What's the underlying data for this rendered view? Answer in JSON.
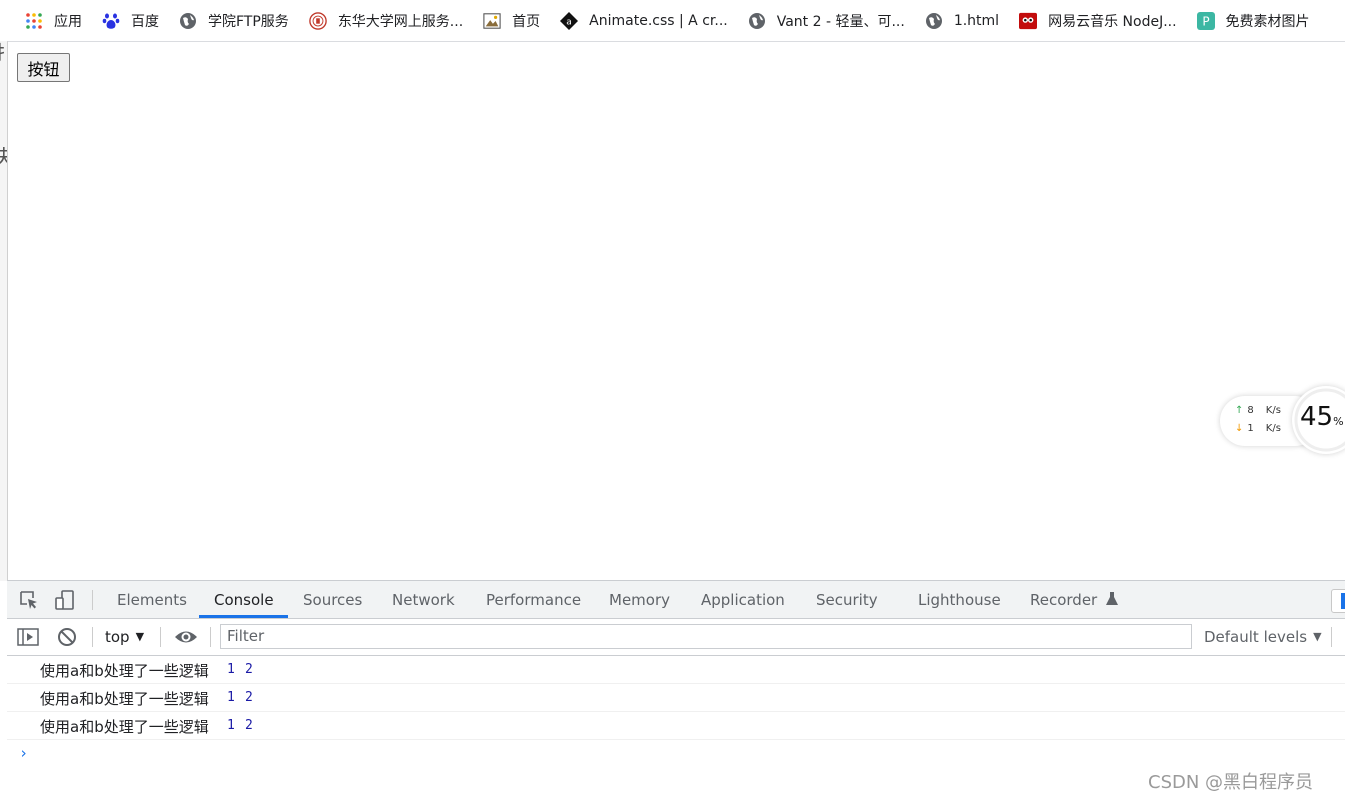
{
  "bookmarks": [
    {
      "label": "应用",
      "icon": "apps-grid-icon"
    },
    {
      "label": "百度",
      "icon": "baidu-paw-icon"
    },
    {
      "label": "学院FTP服务",
      "icon": "globe-icon"
    },
    {
      "label": "东华大学网上服务...",
      "icon": "university-seal-icon"
    },
    {
      "label": "首页",
      "icon": "image-icon"
    },
    {
      "label": "Animate.css | A cr...",
      "icon": "animate-logo-icon"
    },
    {
      "label": "Vant 2 - 轻量、可...",
      "icon": "globe-icon"
    },
    {
      "label": "1.html",
      "icon": "globe-icon"
    },
    {
      "label": "网易云音乐 NodeJ...",
      "icon": "netease-music-icon"
    },
    {
      "label": "免费素材图片",
      "icon": "material-p-icon"
    }
  ],
  "page": {
    "button_label": "按钮",
    "left_fragment_1": "扌",
    "left_fragment_2": "夬"
  },
  "network_widget": {
    "upload": "8",
    "download": "1",
    "unit": "K/s",
    "percent": "45",
    "percent_sign": "%"
  },
  "devtools": {
    "tabs": [
      "Elements",
      "Console",
      "Sources",
      "Network",
      "Performance",
      "Memory",
      "Application",
      "Security",
      "Lighthouse",
      "Recorder"
    ],
    "active_tab": "Console",
    "context": "top",
    "filter_placeholder": "Filter",
    "levels": "Default levels",
    "messages": [
      {
        "text": "使用a和b处理了一些逻辑",
        "a": "1",
        "b": "2"
      },
      {
        "text": "使用a和b处理了一些逻辑",
        "a": "1",
        "b": "2"
      },
      {
        "text": "使用a和b处理了一些逻辑",
        "a": "1",
        "b": "2"
      }
    ],
    "prompt": "›"
  },
  "watermark": "CSDN @黑白程序员",
  "colors": {
    "accent": "#1a73e8",
    "console_number": "#1a1aa6",
    "upload_arrow": "#34a853",
    "download_arrow": "#f29900",
    "gauge": "#f4a261"
  }
}
